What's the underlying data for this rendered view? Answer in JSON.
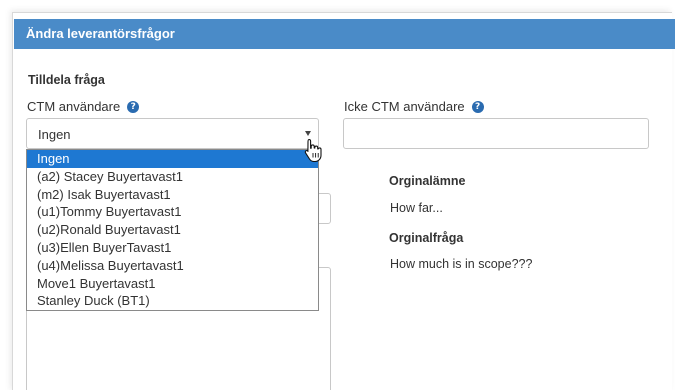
{
  "header": {
    "title": "Ändra leverantörsfrågor"
  },
  "assign": {
    "section_title": "Tilldela fråga",
    "ctm_label": "CTM användare",
    "non_ctm_label": "Icke CTM användare",
    "help_glyph": "?",
    "selected_value": "Ingen",
    "non_ctm_value": "",
    "options": [
      "Ingen",
      "(a2) Stacey Buyertavast1",
      "(m2) Isak Buyertavast1",
      "(u1)Tommy Buyertavast1",
      "(u2)Ronald Buyertavast1",
      "(u3)Ellen BuyerTavast1",
      "(u4)Melissa Buyertavast1",
      "Move1 Buyertavast1",
      "Stanley Duck (BT1)"
    ]
  },
  "original": {
    "subject_label": "Orginalämne",
    "subject_value": "How far...",
    "question_label": "Orginalfråga",
    "question_value": "How much is in scope???"
  },
  "colors": {
    "header_bg": "#4a8bc8",
    "selected_option_bg": "#1e78d2",
    "help_icon_bg": "#2a6bb0"
  },
  "icons": {
    "help": "help-circle-icon",
    "cursor": "hand-pointer-cursor-icon",
    "dropdown_arrow": "caret-down-icon"
  }
}
